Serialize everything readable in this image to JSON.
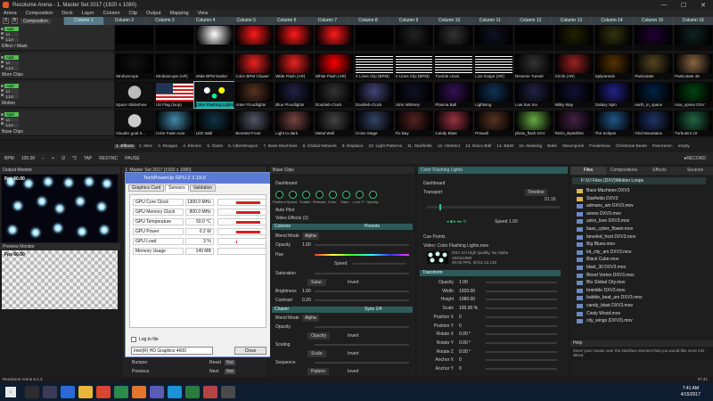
{
  "window": {
    "title": "Resolume Arena - 1. Master Set 2017 (1920 x 1080)"
  },
  "menu": [
    "Arena",
    "Composition",
    "Deck",
    "Layer",
    "Column",
    "Clip",
    "Output",
    "Mapping",
    "View"
  ],
  "header": {
    "composition_label": "Composition",
    "clear_label": "X",
    "b_label": "B"
  },
  "columns": [
    "Column 1",
    "Column 2",
    "Column 3",
    "Column 4",
    "Column 5",
    "Column 6",
    "Column 7",
    "Column 8",
    "Column 9",
    "Column 10",
    "Column 11",
    "Column 12",
    "Column 13",
    "Column 14",
    "Column 15",
    "Column 16"
  ],
  "layers": [
    {
      "name": "Effect / Mask",
      "add": "Add",
      "lt": "Lt",
      "lta": "L1A"
    },
    {
      "name": "More Clips",
      "add": "Add",
      "lt": "Lt",
      "lta": "L1A"
    },
    {
      "name": "Motion",
      "add": "Add",
      "lt": "Lt",
      "lta": "L1A"
    },
    {
      "name": "Base Clips",
      "add": "Alph",
      "lt": "Lt",
      "lta": "L1A"
    }
  ],
  "clips": [
    [
      "",
      "",
      "",
      "",
      "",
      "",
      "",
      "",
      "",
      "",
      "",
      "",
      "",
      "",
      "",
      ""
    ],
    [
      "Stroboscope",
      "Stroboscope (AR)",
      "Wide BPM Dasler",
      "Color BPM Chaser",
      "Wide Flash (AR)",
      "White Flash (AR)",
      "X Lines Clip (BPM)",
      "V Lines Clip (BPM)",
      "Tumble Lines",
      "Low Scape (AR)",
      "Reverse Tunnel",
      "Circle (AR)",
      "Splyramids",
      "Particulate",
      "Particulate 48",
      "Particulate 96"
    ],
    [
      "Space Slideshow",
      "US Flag (loop)",
      "Color Flashing Lights",
      "Anter Floodlights",
      "Blue Floodlights",
      "Doubleb-Clock",
      "Doubleb-Clock",
      "John Whitney",
      "Plasma Ball",
      "Lightning",
      "Low Sun Inn",
      "Milky Way",
      "Galaxy Spin",
      "earth_in_space",
      "now_spiren DXV",
      "enterspectral",
      "Fireplace",
      "Cool Rain 2"
    ],
    [
      "VisualU goal S...",
      "Color Fade Auto",
      "LED Wall",
      "Beveled Frost",
      "Light to dark",
      "Metal Wall",
      "Cross Stage",
      "Fix Bay",
      "Candy Blast",
      "Prewall",
      "photo_flash DXV",
      "Retro_Byte/Elec",
      "The Eclipse",
      "Grid Mountains",
      "Turbulent 10",
      "Colorbound"
    ]
  ],
  "deck_tabs": [
    "1. Effects",
    "2. Misc",
    "3. Reagan",
    "4. Electric",
    "5. Glass",
    "6. UberWeapon",
    "7. Base Machines",
    "8. Global Network",
    "9. Displace",
    "10. Light Patterns",
    "11. Starfields",
    "12. Abstract",
    "13. Disco Ball",
    "14. B&W",
    "15. Masking",
    "Bokk",
    "Steampunk",
    "Freakshow",
    "Christmas Beats",
    "Panoramic",
    "empty"
  ],
  "transport_bar": {
    "bpm_label": "BPM",
    "bpm_value": "105.00",
    "minus": "−",
    "plus": "+",
    "div2": "/2",
    "times2": "*2",
    "tap": "TAP",
    "resync": "RESYNC",
    "pause": "PAUSE",
    "record": "●RECORD"
  },
  "output_monitor": {
    "title": "Output Monitor",
    "fps": "Fps 60.00"
  },
  "preview_monitor": {
    "title": "Preview Monitor",
    "fps": "Fps 60.00"
  },
  "composition_panel": {
    "title": "1. Master Set 2017 (1920 x 1080)"
  },
  "gpuz": {
    "title": "TechPowerUp GPU-Z 1.19.0",
    "tabs": [
      "Graphics Card",
      "Sensors",
      "Validation"
    ],
    "active_tab": "Sensors",
    "sensors": [
      {
        "label": "GPU Core Clock",
        "value": "1300.0 MHz",
        "level": 0.8
      },
      {
        "label": "GPU Memory Clock",
        "value": "800.0 MHz",
        "level": 0.8
      },
      {
        "label": "GPU Temperature",
        "value": "50.0 °C",
        "level": 0.8
      },
      {
        "label": "GPU Power",
        "value": "0.2 W",
        "level": 0.8
      },
      {
        "label": "GPU Load",
        "value": "3 %",
        "level": 0.05
      },
      {
        "label": "Memory Usage",
        "value": "149 MB",
        "level": 0
      }
    ],
    "log_label": "Log to file",
    "adapter": "Intel(R) HD Graphics 4600",
    "close_label": "Close"
  },
  "bump": {
    "bumper": "Bumper",
    "reset": "Reset",
    "previous": "Previous",
    "next": "Next",
    "none": "Not"
  },
  "clip_panel": {
    "title": "Base Clips",
    "dashboard": "Dashboard",
    "knobs": [
      "Platform",
      "Speed",
      "Scatter",
      "Release",
      "Color",
      "Satur.",
      "Lum. P",
      "Opacity"
    ],
    "autopilot": "Auto Pilot",
    "video_effects": "Video Effects (2)",
    "colorize": "Colorize",
    "colorize_presets": "Presets",
    "blend_mode_label": "Blend Mode",
    "blend_mode_value": "Alpha",
    "opacity_label": "Opacity",
    "opacity_value": "1.00",
    "hue_label": "Hue",
    "saturation_label": "Saturation",
    "saturation_mode": "Satur.",
    "invert_label": "Invert",
    "brightness_label": "Brightness",
    "brightness_value": "1.00",
    "contrast_label": "Contrast",
    "contrast_value": "0.20",
    "chaser": "Chaser",
    "chaser_sync": "Sync 1/4",
    "chaser_blend_value": "Alpha",
    "chaser_opacity_label": "Opacity",
    "opacity_mode": "Opacity",
    "scaling_label": "Scaling",
    "scale_mode": "Scale",
    "sequence_label": "Sequence",
    "pattern_mode": "Pattern",
    "speed_label": "Speed"
  },
  "transport_panel": {
    "title": "Color Flashing Lights",
    "dashboard": "Dashboard",
    "transport": "Transport",
    "timeline": "Timeline",
    "time_value": "01:16",
    "speed_label": "Speed",
    "speed_value": "1.00",
    "cue_points": "Cue Points",
    "video_label": "Video: Color Flashing Lights.mov",
    "video_info": "DXV 3.0 High Quality, No Alpha",
    "video_res": "1920x1080",
    "video_fps": "30.00 FPS, 00:01:12.133",
    "transform": "Transform",
    "params": [
      {
        "label": "Opacity",
        "value": "1.00"
      },
      {
        "label": "Width",
        "value": "1920.00"
      },
      {
        "label": "Height",
        "value": "1080.00"
      },
      {
        "label": "Scale",
        "value": "100.00 %"
      },
      {
        "label": "Position X",
        "value": "0"
      },
      {
        "label": "Position Y",
        "value": "0"
      },
      {
        "label": "Rotate X",
        "value": "0.00 °"
      },
      {
        "label": "Rotate Y",
        "value": "0.00 °"
      },
      {
        "label": "Rotate Z",
        "value": "0.00 °"
      },
      {
        "label": "Anchor X",
        "value": "0"
      },
      {
        "label": "Anchor Y",
        "value": "0"
      }
    ]
  },
  "files_panel": {
    "tabs": [
      "Files",
      "Compositions",
      "Effects",
      "Sources"
    ],
    "path": "F:\\VJ Files (DXV)\\Motion Loops",
    "items": [
      {
        "name": "Bass Machines DXV3",
        "type": "folder"
      },
      {
        "name": "Starfields DXV3",
        "type": "folder"
      },
      {
        "name": "admans_am DXV3.mov",
        "type": "movie"
      },
      {
        "name": "annes DXV3.mov",
        "type": "movie"
      },
      {
        "name": "astro_love DXV3.mov",
        "type": "movie"
      },
      {
        "name": "bass_cyber_flower.mov",
        "type": "movie"
      },
      {
        "name": "beveled_frost DXV3.mov",
        "type": "movie"
      },
      {
        "name": "Big Blues.mov",
        "type": "movie"
      },
      {
        "name": "bit_city_am DXV3.mov",
        "type": "movie"
      },
      {
        "name": "Black Cube.mov",
        "type": "movie"
      },
      {
        "name": "blast_30 DXV3.mov",
        "type": "movie"
      },
      {
        "name": "Blood Vortex DXV3.mov",
        "type": "movie"
      },
      {
        "name": "Blu Global City.mov",
        "type": "movie"
      },
      {
        "name": "bramble DXV3.mov",
        "type": "movie"
      },
      {
        "name": "bubble_beat_am DXV3.mov",
        "type": "movie"
      },
      {
        "name": "candy_blast DXV3.mov",
        "type": "movie"
      },
      {
        "name": "Cindy Wood.mov",
        "type": "movie"
      },
      {
        "name": "city_wings (DXV3).mov",
        "type": "movie"
      }
    ]
  },
  "help": {
    "title": "Help",
    "text": "Move your mouse over the interface element that you would like more info about."
  },
  "status": {
    "app": "Resolume Arena 5.1.3",
    "time": "07:41"
  },
  "taskbar": {
    "time": "7:41 AM",
    "date": "4/15/2017"
  },
  "colors": {
    "accent": "#3cc08c",
    "selected_clip": "#22a0a0",
    "highlight_red": "#ff1a1a",
    "gpuz_bar": "#d12020"
  }
}
